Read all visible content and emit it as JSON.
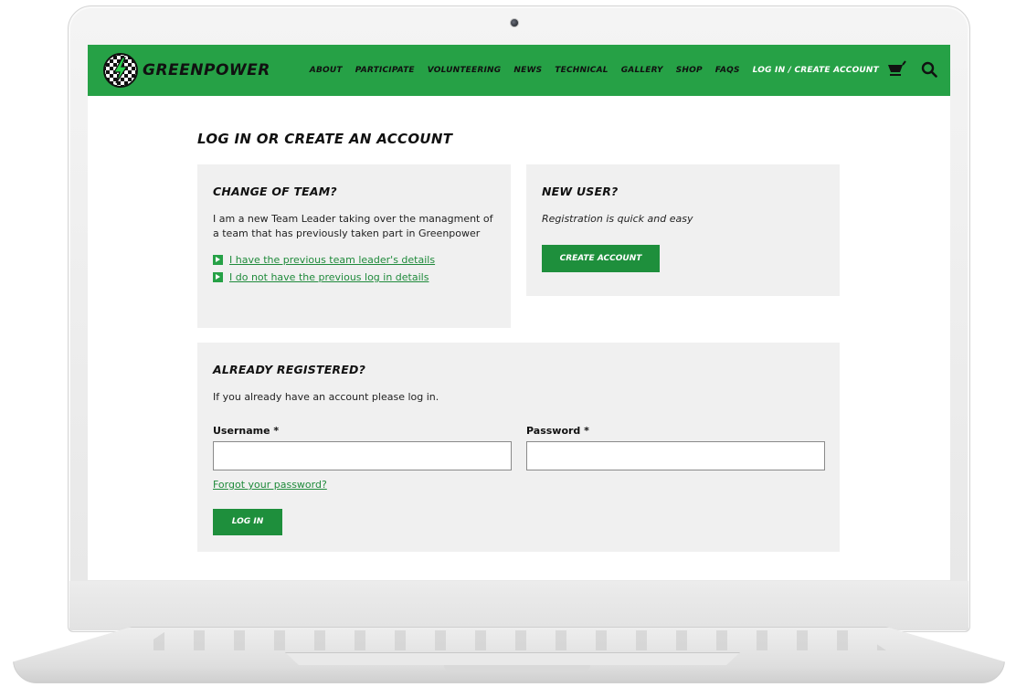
{
  "brand": {
    "name": "GREENPOWER",
    "color": "#26a146"
  },
  "nav": {
    "items": [
      "ABOUT",
      "PARTICIPATE",
      "VOLUNTEERING",
      "NEWS",
      "TECHNICAL",
      "GALLERY",
      "SHOP",
      "FAQS",
      "LOG IN / CREATE ACCOUNT"
    ],
    "active": "LOG IN / CREATE ACCOUNT",
    "icons": [
      "cart-icon",
      "search-icon"
    ]
  },
  "page": {
    "title": "LOG IN OR CREATE AN ACCOUNT"
  },
  "change_team": {
    "heading": "CHANGE OF TEAM?",
    "text": "I am a new Team Leader taking over the managment of a team that has previously taken part in Greenpower",
    "links": [
      "I have the previous team leader's details",
      "I do not have the previous log in details"
    ]
  },
  "new_user": {
    "heading": "NEW USER?",
    "text": "Registration is quick and easy",
    "button": "CREATE ACCOUNT"
  },
  "login": {
    "heading": "ALREADY REGISTERED?",
    "text": "If you already have an account please log in.",
    "username_label": "Username *",
    "username_value": "",
    "password_label": "Password *",
    "password_value": "",
    "forgot": "Forgot your password?",
    "button": "LOG IN"
  }
}
